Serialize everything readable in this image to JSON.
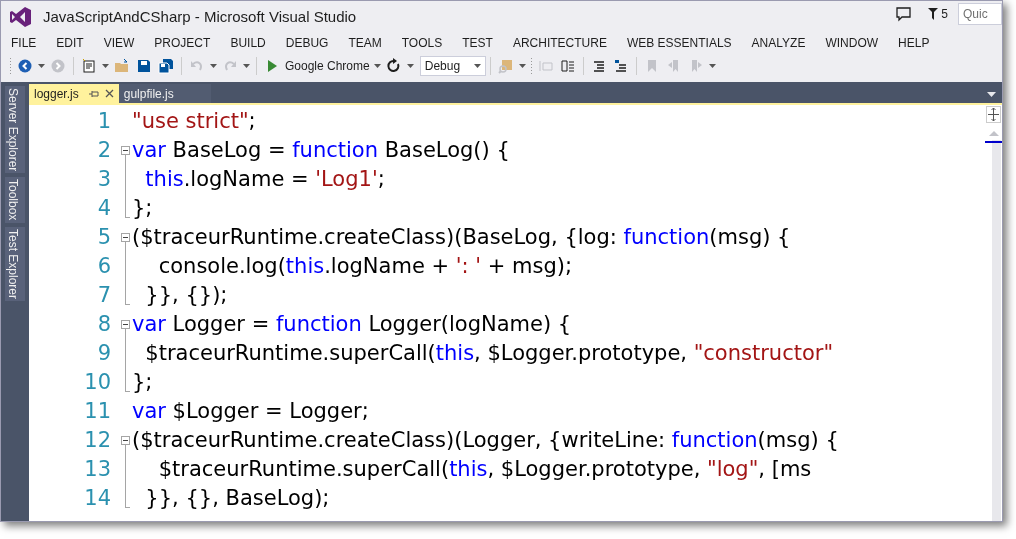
{
  "window": {
    "title": "JavaScriptAndCSharp - Microsoft Visual Studio"
  },
  "title_bar": {
    "notification_count": "5",
    "quick_launch": {
      "placeholder": "Quic"
    }
  },
  "menu": [
    "FILE",
    "EDIT",
    "VIEW",
    "PROJECT",
    "BUILD",
    "DEBUG",
    "TEAM",
    "TOOLS",
    "TEST",
    "ARCHITECTURE",
    "WEB ESSENTIALS",
    "ANALYZE",
    "WINDOW",
    "HELP"
  ],
  "toolbar": {
    "run_target": "Google Chrome",
    "configuration": "Debug",
    "buttons": [
      {
        "disabled": false
      },
      {
        "disabled": true
      },
      {
        "disabled": false
      },
      {
        "disabled": false
      },
      {
        "disabled": false
      },
      {
        "disabled": false
      },
      {
        "disabled": true
      },
      {
        "disabled": true
      },
      {
        "disabled": false
      },
      {
        "disabled": false
      },
      {
        "disabled": true
      },
      {
        "disabled": true
      },
      {
        "disabled": false
      },
      {
        "disabled": false
      },
      {
        "disabled": false
      },
      {
        "disabled": true
      },
      {
        "disabled": true
      },
      {
        "disabled": true
      }
    ]
  },
  "side_tabs": [
    "Server Explorer",
    "Toolbox",
    "Test Explorer"
  ],
  "tabs": [
    {
      "label": "logger.js",
      "selected": true
    },
    {
      "label": "gulpfile.js",
      "selected": false
    }
  ],
  "editor": {
    "lines": [
      {
        "number": "1",
        "kind": "plain",
        "tokens": [
          {
            "kind": "string",
            "text": "\"use strict\""
          },
          {
            "kind": "plain",
            "text": ";"
          }
        ]
      },
      {
        "number": "2",
        "kind": "fold-start",
        "tokens": [
          {
            "kind": "keyword",
            "text": "var"
          },
          {
            "kind": "plain",
            "text": " BaseLog = "
          },
          {
            "kind": "keyword",
            "text": "function"
          },
          {
            "kind": "plain",
            "text": " BaseLog() {"
          }
        ]
      },
      {
        "number": "3",
        "kind": "fold-body",
        "tokens": [
          {
            "kind": "keyword",
            "text": "  this"
          },
          {
            "kind": "plain",
            "text": ".logName = "
          },
          {
            "kind": "string",
            "text": "'Log1'"
          },
          {
            "kind": "plain",
            "text": ";"
          }
        ]
      },
      {
        "number": "4",
        "kind": "fold-end",
        "tokens": [
          {
            "kind": "plain",
            "text": "};"
          }
        ]
      },
      {
        "number": "5",
        "kind": "fold-start",
        "tokens": [
          {
            "kind": "plain",
            "text": "($traceurRuntime.createClass)(BaseLog, {log: "
          },
          {
            "kind": "keyword",
            "text": "function"
          },
          {
            "kind": "plain",
            "text": "(msg) {"
          }
        ]
      },
      {
        "number": "6",
        "kind": "fold-body",
        "tokens": [
          {
            "kind": "plain",
            "text": "    console.log("
          },
          {
            "kind": "keyword",
            "text": "this"
          },
          {
            "kind": "plain",
            "text": ".logName + "
          },
          {
            "kind": "string",
            "text": "': '"
          },
          {
            "kind": "plain",
            "text": " + msg);"
          }
        ]
      },
      {
        "number": "7",
        "kind": "fold-end",
        "tokens": [
          {
            "kind": "plain",
            "text": "  }}, {});"
          }
        ]
      },
      {
        "number": "8",
        "kind": "fold-start",
        "tokens": [
          {
            "kind": "keyword",
            "text": "var"
          },
          {
            "kind": "plain",
            "text": " Logger = "
          },
          {
            "kind": "keyword",
            "text": "function"
          },
          {
            "kind": "plain",
            "text": " Logger(logName) {"
          }
        ]
      },
      {
        "number": "9",
        "kind": "fold-body",
        "tokens": [
          {
            "kind": "plain",
            "text": "  $traceurRuntime.superCall("
          },
          {
            "kind": "keyword",
            "text": "this"
          },
          {
            "kind": "plain",
            "text": ", $Logger.prototype, "
          },
          {
            "kind": "string",
            "text": "\"constructor\""
          }
        ]
      },
      {
        "number": "10",
        "kind": "fold-end",
        "tokens": [
          {
            "kind": "plain",
            "text": "};"
          }
        ]
      },
      {
        "number": "11",
        "kind": "plain",
        "tokens": [
          {
            "kind": "keyword",
            "text": "var"
          },
          {
            "kind": "plain",
            "text": " $Logger = Logger;"
          }
        ]
      },
      {
        "number": "12",
        "kind": "fold-start",
        "tokens": [
          {
            "kind": "plain",
            "text": "($traceurRuntime.createClass)(Logger, {writeLine: "
          },
          {
            "kind": "keyword",
            "text": "function"
          },
          {
            "kind": "plain",
            "text": "(msg) {"
          }
        ]
      },
      {
        "number": "13",
        "kind": "fold-body",
        "tokens": [
          {
            "kind": "plain",
            "text": "    $traceurRuntime.superCall("
          },
          {
            "kind": "keyword",
            "text": "this"
          },
          {
            "kind": "plain",
            "text": ", $Logger.prototype, "
          },
          {
            "kind": "string",
            "text": "\"log\""
          },
          {
            "kind": "plain",
            "text": ", [ms"
          }
        ]
      },
      {
        "number": "14",
        "kind": "fold-end",
        "tokens": [
          {
            "kind": "plain",
            "text": "  }}, {}, BaseLog);"
          }
        ]
      }
    ]
  }
}
